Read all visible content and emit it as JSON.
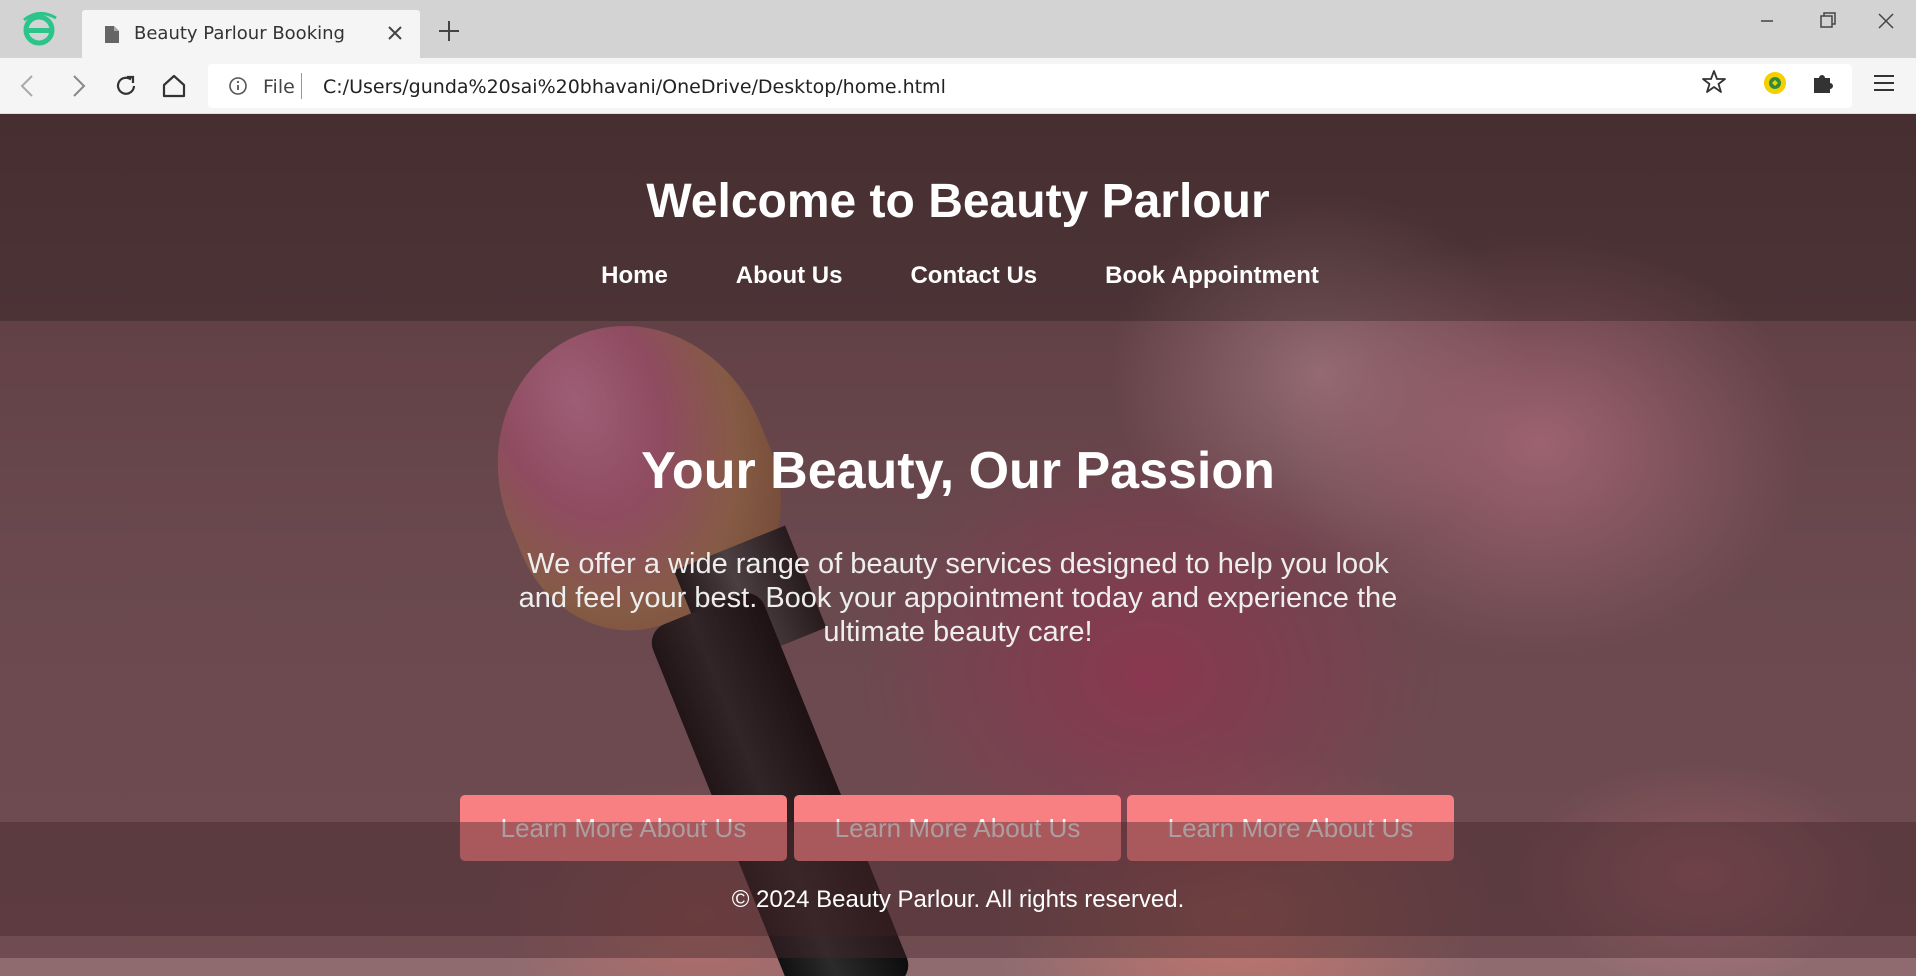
{
  "browser": {
    "tab_title": "Beauty Parlour Booking",
    "url_scheme": "File",
    "url": "C:/Users/gunda%20sai%20bhavani/OneDrive/Desktop/home.html",
    "icons": [
      "browser-logo-icon",
      "page-icon",
      "close-icon",
      "plus-icon",
      "minimize-icon",
      "restore-icon",
      "window-close-icon",
      "back-icon",
      "forward-icon",
      "reload-icon",
      "home-icon",
      "info-icon",
      "star-icon",
      "extension-avatar-icon",
      "puzzle-icon",
      "menu-icon"
    ]
  },
  "header": {
    "title": "Welcome to Beauty Parlour",
    "nav": [
      {
        "label": "Home"
      },
      {
        "label": "About Us"
      },
      {
        "label": "Contact Us"
      },
      {
        "label": "Book Appointment"
      }
    ]
  },
  "hero": {
    "title": "Your Beauty, Our Passion",
    "text": "We offer a wide range of beauty services designed to help you look and feel your best. Book your appointment today and experience the ultimate beauty care!",
    "buttons": [
      {
        "label": "Learn More About Us"
      },
      {
        "label": "Learn More About Us"
      },
      {
        "label": "Learn More About Us"
      }
    ]
  },
  "footer": {
    "text": "© 2024 Beauty Parlour. All rights reserved."
  },
  "colors": {
    "cta": "#f98082",
    "header_overlay": "#281618",
    "tabbar": "#d3d3d3",
    "toolbar": "#f5f5f5"
  }
}
